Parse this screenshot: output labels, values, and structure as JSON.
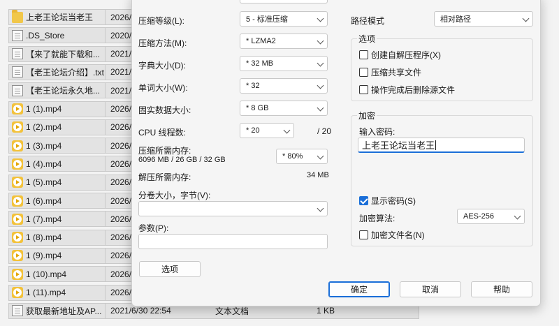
{
  "file_list": [
    {
      "icon": "folder-icon",
      "name": "上老王论坛当老王",
      "date": "2026/",
      "type": "",
      "size": ""
    },
    {
      "icon": "document-icon",
      "name": ".DS_Store",
      "date": "2020/",
      "type": "",
      "size": ""
    },
    {
      "icon": "document-icon",
      "name": "【来了就能下载和...",
      "date": "2021/",
      "type": "",
      "size": ""
    },
    {
      "icon": "document-icon",
      "name": "【老王论坛介绍】.txt",
      "date": "2021/",
      "type": "",
      "size": ""
    },
    {
      "icon": "document-icon",
      "name": "【老王论坛永久地...",
      "date": "2021/",
      "type": "",
      "size": ""
    },
    {
      "icon": "video-icon",
      "name": "1 (1).mp4",
      "date": "2026/",
      "type": "",
      "size": ""
    },
    {
      "icon": "video-icon",
      "name": "1 (2).mp4",
      "date": "2026/",
      "type": "",
      "size": ""
    },
    {
      "icon": "video-icon",
      "name": "1 (3).mp4",
      "date": "2026/",
      "type": "",
      "size": ""
    },
    {
      "icon": "video-icon",
      "name": "1 (4).mp4",
      "date": "2026/",
      "type": "",
      "size": ""
    },
    {
      "icon": "video-icon",
      "name": "1 (5).mp4",
      "date": "2026/",
      "type": "",
      "size": ""
    },
    {
      "icon": "video-icon",
      "name": "1 (6).mp4",
      "date": "2026/",
      "type": "",
      "size": ""
    },
    {
      "icon": "video-icon",
      "name": "1 (7).mp4",
      "date": "2026/",
      "type": "",
      "size": ""
    },
    {
      "icon": "video-icon",
      "name": "1 (8).mp4",
      "date": "2026/",
      "type": "",
      "size": ""
    },
    {
      "icon": "video-icon",
      "name": "1 (9).mp4",
      "date": "2026/",
      "type": "",
      "size": ""
    },
    {
      "icon": "video-icon",
      "name": "1 (10).mp4",
      "date": "2026/",
      "type": "",
      "size": ""
    },
    {
      "icon": "video-icon",
      "name": "1 (11).mp4",
      "date": "2026/",
      "type": "",
      "size": ""
    },
    {
      "icon": "document-icon",
      "name": "获取最新地址及AP...",
      "date": "2021/6/30 22:54",
      "type": "文本文档",
      "size": "1 KB"
    }
  ],
  "dialog": {
    "compression_level": {
      "label": "压缩等级(L):",
      "value": "5 - 标准压缩"
    },
    "compression_method": {
      "label": "压缩方法(M):",
      "value": "* LZMA2"
    },
    "dictionary_size": {
      "label": "字典大小(D):",
      "value": "* 32 MB"
    },
    "word_size": {
      "label": "单词大小(W):",
      "value": "* 32"
    },
    "solid_block_size": {
      "label": "固实数据大小:",
      "value": "* 8 GB"
    },
    "cpu_threads": {
      "label": "CPU 线程数:",
      "value": "* 20",
      "max": "/ 20"
    },
    "memory_compress": {
      "label": "压缩所需内存:",
      "detail": "6096 MB / 26 GB / 32 GB",
      "value": "* 80%"
    },
    "memory_decompress": {
      "label": "解压所需内存:",
      "value": "34 MB"
    },
    "split_volumes": {
      "label": "分卷大小，字节(V):",
      "value": ""
    },
    "parameters": {
      "label": "参数(P):",
      "value": ""
    },
    "options_button": "选项",
    "path_mode": {
      "label": "路径模式",
      "value": "相对路径"
    },
    "options_group": {
      "title": "选项",
      "items": [
        {
          "label": "创建自解压程序(X)",
          "checked": false
        },
        {
          "label": "压缩共享文件",
          "checked": false
        },
        {
          "label": "操作完成后删除源文件",
          "checked": false
        }
      ]
    },
    "encryption": {
      "title": "加密",
      "password_label": "输入密码:",
      "password_value": "上老王论坛当老王",
      "show_password": {
        "label": "显示密码(S)",
        "checked": true
      },
      "method_label": "加密算法:",
      "method_value": "AES-256",
      "encrypt_names": {
        "label": "加密文件名(N)",
        "checked": false
      }
    },
    "buttons": {
      "ok": "确定",
      "cancel": "取消",
      "help": "帮助"
    }
  }
}
